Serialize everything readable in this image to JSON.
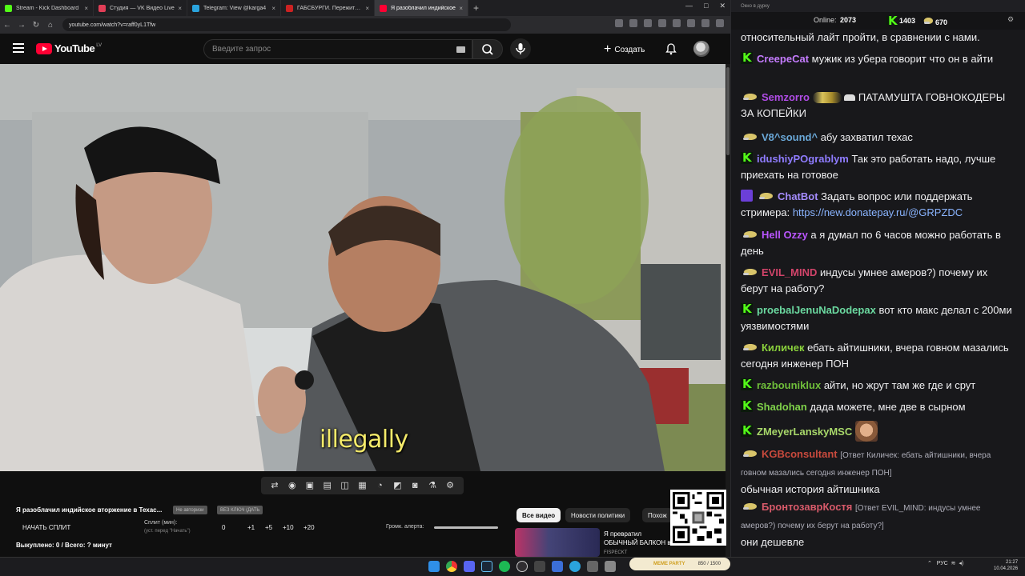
{
  "browser": {
    "tabs": [
      {
        "title": "Stream - Kick Dashboard",
        "color": "#53fc18",
        "active": false
      },
      {
        "title": "Студия — VK Видео Live",
        "color": "#e23e57",
        "active": false
      },
      {
        "title": "Telegram: View @karga4",
        "color": "#2aa3dd",
        "active": false
      },
      {
        "title": "ГАБСБУРГИ. Пережить индустр",
        "color": "#cc2222",
        "active": false
      },
      {
        "title": "Я разоблачил индийское",
        "color": "#ff0033",
        "active": true
      }
    ],
    "new_tab": "+",
    "url": "youtube.com/watch?v=raff0yL1Tfw"
  },
  "youtube": {
    "logo": "YouTube",
    "region": "LV",
    "search_placeholder": "Введите запрос",
    "create_label": "Создать",
    "subtitle": "illegally",
    "video_title": "Я разоблачил индийское вторжение в Техас...",
    "pill_1": "Не авторизи",
    "pill_2": "ВЕЗ КЛЮЧ (ДАТЬ",
    "start_split": "НАЧАТЬ СПЛИТ",
    "split_label": "Сплит (мин):",
    "split_hint": "(уст. перед \"Начать\")",
    "split_values": [
      "0",
      "+1",
      "+5",
      "+10",
      "+20"
    ],
    "bought": "Выкуплено: 0 / Всего: ? минут",
    "alert_label": "Громк. алерта:",
    "chips": [
      "Все видео",
      "Новости политики",
      "Похож"
    ],
    "rec_title": "Я превратил ОБЫЧНЫЙ БАЛКОН в ГЕЙМЕРС",
    "rec_channel": "FISPECKT"
  },
  "chat": {
    "window_title": "Окно в дурку",
    "online_label": "Online:",
    "online_count": "2073",
    "kick_count": "1403",
    "d_count": "670",
    "messages": [
      {
        "badge": "none",
        "user": "",
        "color": "#efeff1",
        "text": "относительный лайт пройти, в сравнении с нами."
      },
      {
        "badge": "kick",
        "user": "CreepeCat",
        "color": "#c57cff",
        "text": "мужик из убера говорит что он в айти"
      },
      {
        "badge": "d",
        "user": "Semzorro",
        "color": "#b04ce6",
        "text": "ПАТАМУШТА ГОВНОКОДЕРЫ ЗА КОПЕЙКИ"
      },
      {
        "badge": "d",
        "user": "V8^sound^",
        "color": "#6aa8d8",
        "text": "абу захватил техас"
      },
      {
        "badge": "kick",
        "user": "idushiyPOgrablym",
        "color": "#8f7cff",
        "text": "Так это работать надо, лучше приехать на готовое"
      },
      {
        "badge": "bot",
        "user": "ChatBot",
        "color": "#a58cff",
        "text": "Задать вопрос или поддержать стримера:",
        "link": "https://new.donatepay.ru/@GRPZDC"
      },
      {
        "badge": "d",
        "user": "Hell Ozzy",
        "color": "#b955ff",
        "text": "а я думал по 6 часов можно работать в день"
      },
      {
        "badge": "d",
        "user": "EVIL_MIND",
        "color": "#d2446a",
        "text": "индусы умнее амеров?) почему их берут на работу?"
      },
      {
        "badge": "kick",
        "user": "proebalJenuNaDodepax",
        "color": "#6bd9a0",
        "text": "вот кто макс делал с 200ми уязвимостями"
      },
      {
        "badge": "d",
        "user": "Киличек",
        "color": "#8ad13c",
        "text": "ебать айтишники, вчера говном мазались сегодня инженер ПОН"
      },
      {
        "badge": "kick",
        "user": "razbouniklux",
        "color": "#6fbf3a",
        "text": "айти, но жрут там же где и срут"
      },
      {
        "badge": "kick",
        "user": "Shadohan",
        "color": "#7fd14a",
        "text": "дада можете, мне две в сырном"
      },
      {
        "badge": "kick",
        "user": "ZMeyerLanskyMSC",
        "color": "#a8d86a",
        "text": ""
      },
      {
        "badge": "d",
        "user": "KGBconsultant",
        "color": "#c94a3d",
        "reply": "[Ответ Киличек: ебать айтишники, вчера говном мазались сегодня инженер ПОН]",
        "text": "обычная история айтишника"
      },
      {
        "badge": "d",
        "user": "БронтозаврКостя",
        "color": "#d85a6a",
        "reply": "[Ответ EVIL_MIND: индусы умнее амеров?) почему их берут на работу?]",
        "text": "они дешевле"
      }
    ]
  },
  "taskbar": {
    "meme_party": "MEME PARTY",
    "meme_progress": "850 / 1500",
    "lang": "РУС",
    "time": "21:27",
    "date": "10.04.2026"
  },
  "colors": {
    "kick_green": "#53fc18",
    "youtube_red": "#ff0033",
    "subtitle_yellow": "#f4ea6a",
    "chat_bg": "#18181b"
  },
  "icons": [
    "hamburger-icon",
    "search-icon",
    "mic-icon",
    "bell-icon",
    "plus-icon",
    "kick-badge-icon",
    "donate-badge-icon",
    "chatbot-badge-icon"
  ]
}
